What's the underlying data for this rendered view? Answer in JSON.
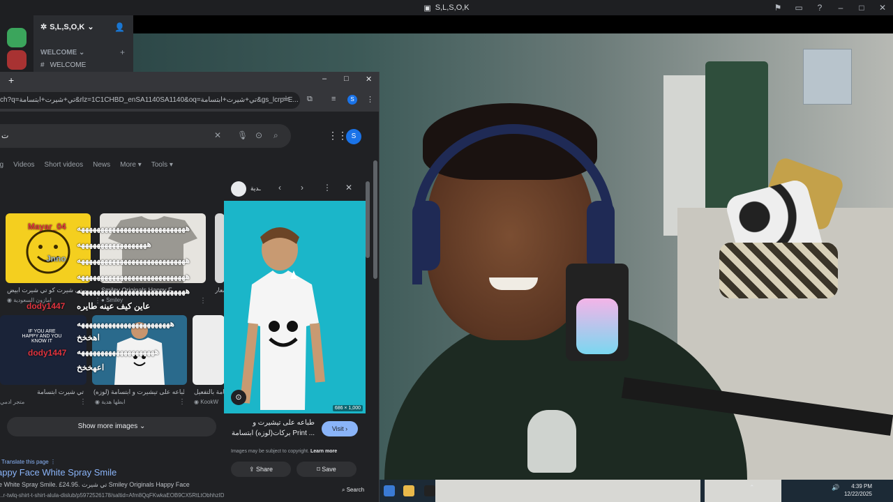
{
  "discord": {
    "window_title": "S,L,S,O,K",
    "server_name": "S,L,S,O,K",
    "category": "WELCOME",
    "channel": "WELCOME"
  },
  "browser": {
    "url": "ch?q=تي+شيرت+ابتسامة&rlz=1C1CHBD_enSA1140SA1140&oq=تي+شيرت+ابتسامة&gs_lcrp=E...",
    "profile_initial": "S",
    "search_query": "ت",
    "filters": [
      "ng",
      "Videos",
      "Short videos",
      "News",
      "More ▾",
      "Tools ▾"
    ],
    "image_results_row1": [
      {
        "caption": "ـيرو تي شيرت كو تي شيرت ابيض",
        "source": "امازون السعودية"
      },
      {
        "caption": "Smiley Originals Happy F...",
        "source": "Smiley"
      },
      {
        "caption": "سعار",
        "source": ""
      }
    ],
    "image_results_row2": [
      {
        "caption": "تي شيرت ابتسامة",
        "source": "متجر ادمي"
      },
      {
        "caption": "طباعه على تيشيرت و ابتسامة (لوزه)",
        "source": "ابطها هدية"
      },
      {
        "caption": "ـسامة بالتفعيل",
        "source": "KookW"
      }
    ],
    "thumb_text": "IF YOU ARE HAPPY AND YOU KNOW IT",
    "show_more": "Show more images",
    "translate": "Translate this page",
    "result_title": "appy Face White Spray Smile",
    "result_desc": "e White Spray Smile. £24.95. تي شيرت Smiley Originals Happy Face",
    "result_url": "...r-twlq-shirt-t-shirt-alula-dislub/p5972526178/saltid=Afm8QqFKwkaEOB9CX5RtLtObhhzIDGfzz7RWpa8mJmD5H9pakiEH...",
    "panel": {
      "site_name": "ـدية",
      "image_size": "686 × 1,000",
      "title": "طباعه على تيشيرت و بركات(لوزه) ابتسامة Print ...",
      "visit": "Visit ›",
      "copyright_prefix": "Images may be subject to copyright.",
      "learn_more": "Learn more",
      "share": "Share",
      "save": "Save"
    }
  },
  "chat_overlay": {
    "lines": [
      "ههههههههههههههههههههههههههههه",
      "ههههههههههههههههههه",
      "ههههههههههههههههههههههههههههه",
      "ههههههههههههههههههههههههههههه",
      "ههههههههههههههههههههههههههههه",
      "عاين كيف عينه طايره",
      "ههههههههههههههههههههههههه",
      "اهخخخ",
      "ههههههههههههههههههههه",
      "اعهخخخ"
    ],
    "users": [
      "Mayar_04",
      "Jnno",
      "dody1447",
      "dody1447"
    ]
  },
  "taskbar": {
    "time": "4:39 PM",
    "date": "12/22/2025",
    "search": "Search"
  }
}
